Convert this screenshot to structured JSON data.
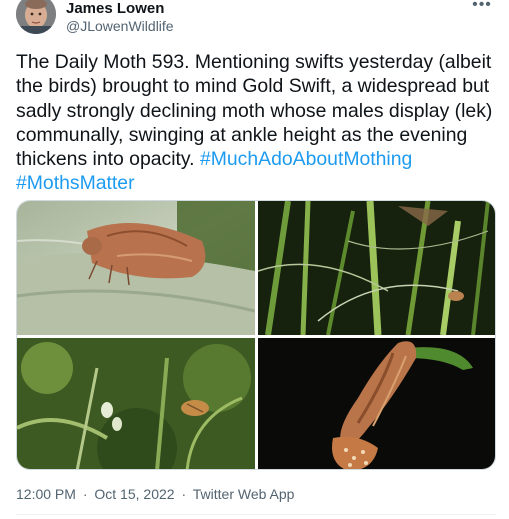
{
  "author": {
    "name": "James Lowen",
    "handle": "@JLowenWildlife"
  },
  "tweet": {
    "text": "The Daily Moth 593. Mentioning swifts yesterday (albeit the birds) brought to mind Gold Swift, a widespread but sadly strongly declining moth whose males display (lek) communally, swinging at ankle height as the evening thickens into opacity.",
    "hashtags": [
      "#MuchAdoAboutMothing",
      "#MothsMatter"
    ]
  },
  "meta": {
    "time": "12:00 PM",
    "date": "Oct 15, 2022",
    "separator": "·",
    "source": "Twitter Web App"
  },
  "icons": {
    "more": "more-options-icon"
  },
  "colors": {
    "link": "#1d9bf0",
    "secondary_text": "#536471",
    "primary_text": "#0f1419"
  }
}
